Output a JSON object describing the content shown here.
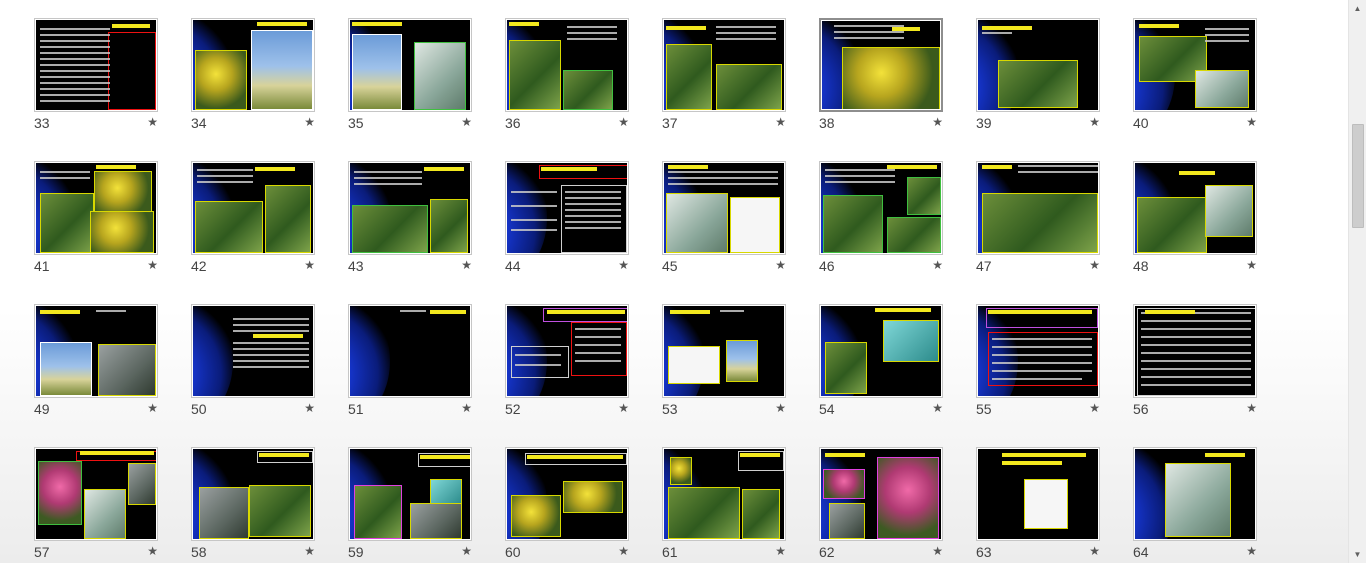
{
  "slides": [
    {
      "number": "33",
      "star": "★",
      "selected": false
    },
    {
      "number": "34",
      "star": "★",
      "selected": false
    },
    {
      "number": "35",
      "star": "★",
      "selected": false
    },
    {
      "number": "36",
      "star": "★",
      "selected": false
    },
    {
      "number": "37",
      "star": "★",
      "selected": false
    },
    {
      "number": "38",
      "star": "★",
      "selected": true
    },
    {
      "number": "39",
      "star": "★",
      "selected": false
    },
    {
      "number": "40",
      "star": "★",
      "selected": false
    },
    {
      "number": "41",
      "star": "★",
      "selected": false
    },
    {
      "number": "42",
      "star": "★",
      "selected": false
    },
    {
      "number": "43",
      "star": "★",
      "selected": false
    },
    {
      "number": "44",
      "star": "★",
      "selected": false
    },
    {
      "number": "45",
      "star": "★",
      "selected": false
    },
    {
      "number": "46",
      "star": "★",
      "selected": false
    },
    {
      "number": "47",
      "star": "★",
      "selected": false
    },
    {
      "number": "48",
      "star": "★",
      "selected": false
    },
    {
      "number": "49",
      "star": "★",
      "selected": false
    },
    {
      "number": "50",
      "star": "★",
      "selected": false
    },
    {
      "number": "51",
      "star": "★",
      "selected": false
    },
    {
      "number": "52",
      "star": "★",
      "selected": false
    },
    {
      "number": "53",
      "star": "★",
      "selected": false
    },
    {
      "number": "54",
      "star": "★",
      "selected": false
    },
    {
      "number": "55",
      "star": "★",
      "selected": false
    },
    {
      "number": "56",
      "star": "★",
      "selected": false
    },
    {
      "number": "57",
      "star": "★",
      "selected": false
    },
    {
      "number": "58",
      "star": "★",
      "selected": false
    },
    {
      "number": "59",
      "star": "★",
      "selected": false
    },
    {
      "number": "60",
      "star": "★",
      "selected": false
    },
    {
      "number": "61",
      "star": "★",
      "selected": false
    },
    {
      "number": "62",
      "star": "★",
      "selected": false
    },
    {
      "number": "63",
      "star": "★",
      "selected": false
    },
    {
      "number": "64",
      "star": "★",
      "selected": false
    }
  ],
  "scrollbar": {
    "up_icon": "▲",
    "down_icon": "▼"
  },
  "colors": {
    "slide_bg": "#000000",
    "title_yellow": "#f2e81e",
    "frame_red": "#ee1111",
    "frame_green": "#3fbf3f",
    "frame_magenta": "#c050e0",
    "glow_blue": "#1534c9"
  }
}
